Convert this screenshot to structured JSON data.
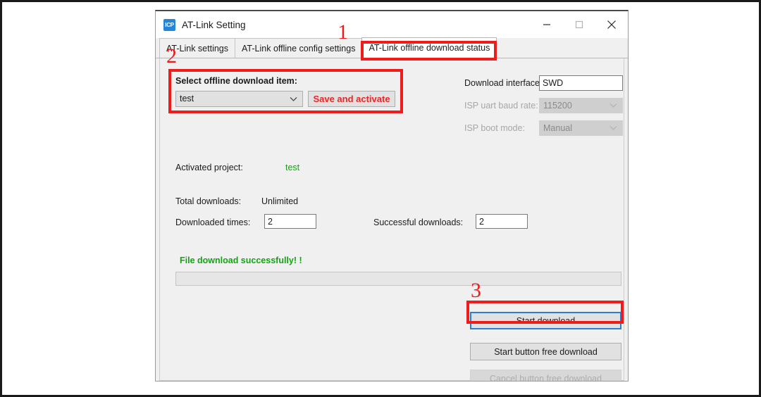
{
  "window": {
    "title": "AT-Link Setting",
    "icon_label": "ICP",
    "icon_name": "icp-app-icon",
    "controls": {
      "minimize": "minimize-icon",
      "maximize": "maximize-icon",
      "close": "close-icon"
    }
  },
  "tabs": [
    {
      "label": "AT-Link settings",
      "active": false
    },
    {
      "label": "AT-Link offline config settings",
      "active": false
    },
    {
      "label": "AT-Link offline download status",
      "active": true
    }
  ],
  "offline_item_group": {
    "title": "Select  offline download item:",
    "combo_value": "test",
    "combo_icon": "chevron-down-icon",
    "save_button": "Save and activate"
  },
  "interface_group": {
    "download_interface_label": "Download interface:",
    "download_interface_value": "SWD",
    "isp_baud_label": "ISP uart baud rate:",
    "isp_baud_value": "115200",
    "isp_boot_label": "ISP boot mode:",
    "isp_boot_value": "Manual",
    "chevron_icon": "chevron-down-icon"
  },
  "status": {
    "activated_project_label": "Activated project:",
    "activated_project_value": "test",
    "total_downloads_label": "Total downloads:",
    "total_downloads_value": "Unlimited",
    "downloaded_times_label": "Downloaded times:",
    "downloaded_times_value": "2",
    "successful_downloads_label": "Successful downloads:",
    "successful_downloads_value": "2",
    "message": "File download successfully!  !",
    "message_color": "#13a313",
    "progress_percent": 0
  },
  "actions": {
    "start_download": "Start download",
    "start_button_free_download": "Start button free download",
    "cancel_button_free_download": "Cancel button free download"
  },
  "annotations": {
    "accent_color": "#ef1c1c",
    "markers": [
      {
        "number": "1",
        "target": "tab-offline-download-status"
      },
      {
        "number": "2",
        "target": "offline-item-group"
      },
      {
        "number": "3",
        "target": "start-download-button"
      }
    ]
  }
}
